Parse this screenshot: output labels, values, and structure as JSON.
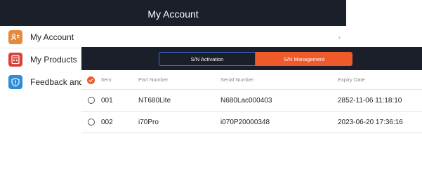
{
  "header": {
    "title": "My Account"
  },
  "menu": {
    "items": [
      {
        "label": "My Account",
        "icon": "account-card-icon"
      },
      {
        "label": "My Products",
        "icon": "products-icon"
      },
      {
        "label": "Feedback and S",
        "icon": "feedback-shield-icon"
      }
    ]
  },
  "tabs": {
    "activation": "S/N Activation",
    "management": "S/N Management",
    "active": "management"
  },
  "table": {
    "columns": [
      "Item",
      "Part Number",
      "Serial Number",
      "Expiry Date"
    ],
    "rows": [
      {
        "item": "001",
        "part": "NT680Lite",
        "serial": "N680Lac000403",
        "expiry": "2852-11-06 11:18:10"
      },
      {
        "item": "002",
        "part": "i70Pro",
        "serial": "i070P20000348",
        "expiry": "2023-06-20 17:36:16"
      }
    ]
  },
  "colors": {
    "dark": "#1b1f2a",
    "accent": "#ef5a2b",
    "tab_border": "#3d6fd8"
  }
}
